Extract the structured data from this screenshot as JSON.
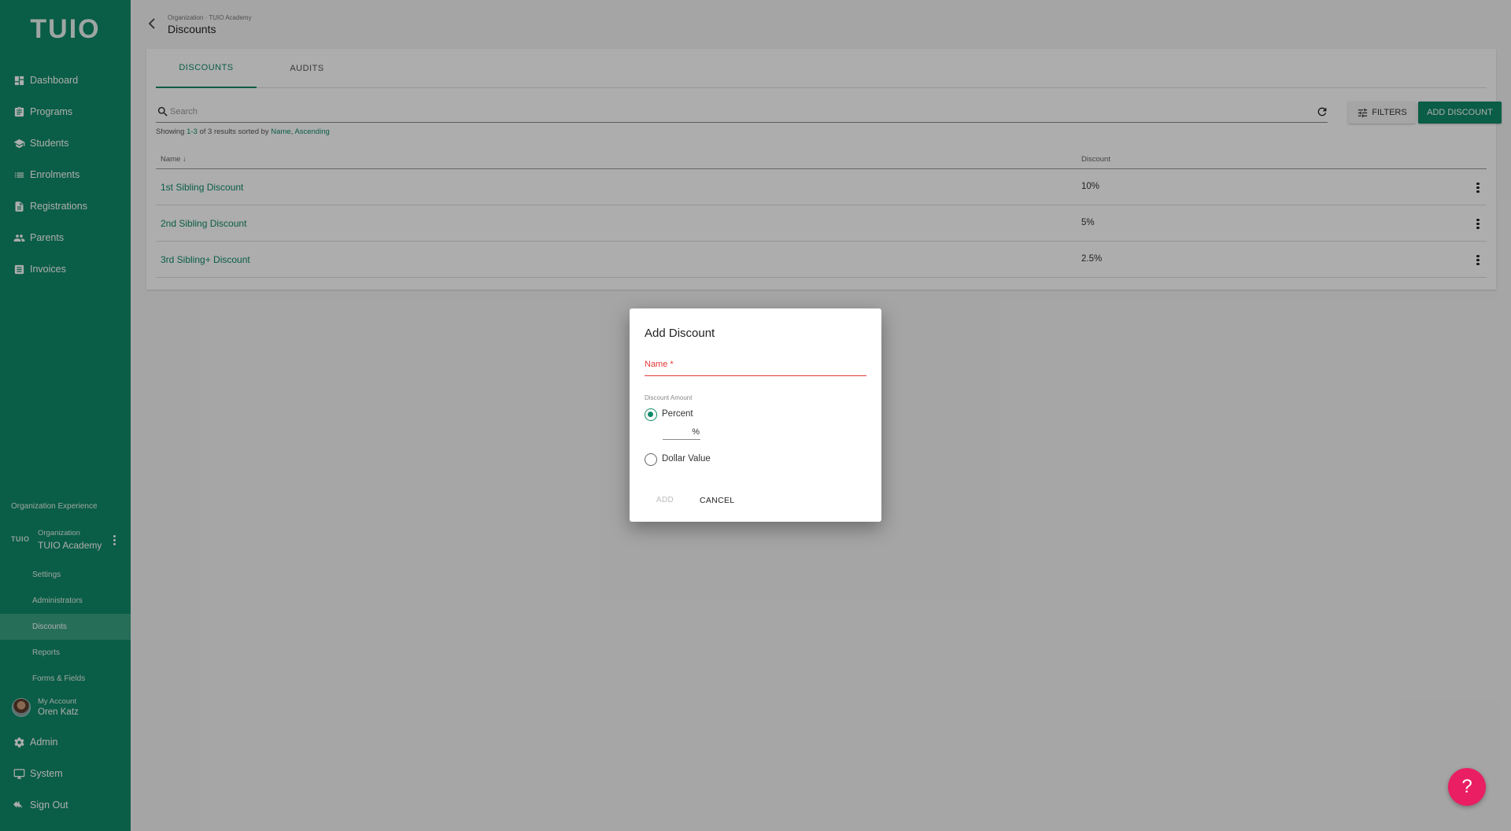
{
  "app": {
    "logo": "TUIO",
    "accent": "#0f8a68",
    "help_color": "#e91e63"
  },
  "sidebar": {
    "nav": [
      {
        "label": "Dashboard",
        "icon": "dashboard-icon"
      },
      {
        "label": "Programs",
        "icon": "clipboard-icon"
      },
      {
        "label": "Students",
        "icon": "graduation-cap-icon"
      },
      {
        "label": "Enrolments",
        "icon": "list-icon"
      },
      {
        "label": "Registrations",
        "icon": "document-icon"
      },
      {
        "label": "Parents",
        "icon": "people-icon"
      },
      {
        "label": "Invoices",
        "icon": "receipt-icon"
      }
    ],
    "org_experience": "Organization Experience",
    "org": {
      "mini_logo": "TUIO",
      "small": "Organization",
      "name": "TUIO Academy"
    },
    "sub_nav": [
      {
        "label": "Settings"
      },
      {
        "label": "Administrators"
      },
      {
        "label": "Discounts",
        "active": true
      },
      {
        "label": "Reports"
      },
      {
        "label": "Forms & Fields"
      }
    ],
    "account": {
      "small": "My Account",
      "name": "Oren Katz"
    },
    "bottom_nav": [
      {
        "label": "Admin",
        "icon": "gear-icon"
      },
      {
        "label": "System",
        "icon": "monitor-icon"
      },
      {
        "label": "Sign Out",
        "icon": "sign-out-icon"
      }
    ]
  },
  "header": {
    "breadcrumb": "Organization · TUIO Academy",
    "title": "Discounts"
  },
  "tabs": [
    {
      "label": "DISCOUNTS",
      "active": true
    },
    {
      "label": "AUDITS"
    }
  ],
  "search": {
    "placeholder": "Search"
  },
  "toolbar": {
    "filters_label": "FILTERS",
    "add_label": "ADD DISCOUNT"
  },
  "showing": {
    "prefix": "Showing ",
    "range": "1-3",
    "middle": " of 3 results sorted by ",
    "sort_field": "Name",
    "comma": ", ",
    "sort_dir": "Ascending"
  },
  "table": {
    "columns": [
      "Name",
      "Discount"
    ],
    "rows": [
      {
        "name": "1st Sibling Discount",
        "discount": "10%"
      },
      {
        "name": "2nd Sibling Discount",
        "discount": "5%"
      },
      {
        "name": "3rd Sibling+ Discount",
        "discount": "2.5%"
      }
    ]
  },
  "dialog": {
    "title": "Add Discount",
    "name_label": "Name *",
    "amount_label": "Discount Amount",
    "percent_label": "Percent",
    "percent_suffix": "%",
    "dollar_label": "Dollar Value",
    "selected": "Percent",
    "add_label": "ADD",
    "cancel_label": "CANCEL"
  },
  "help_label": "?"
}
